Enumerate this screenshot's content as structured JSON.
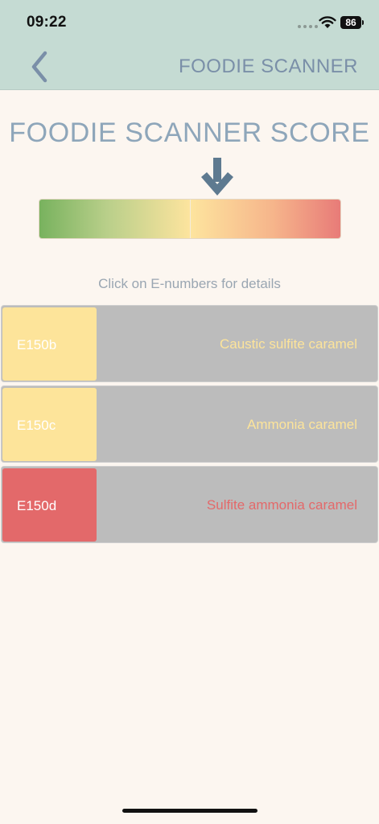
{
  "status_bar": {
    "time": "09:22",
    "battery": "86",
    "signal_icon": "signal-dots-icon",
    "wifi_icon": "wifi-icon"
  },
  "nav": {
    "back_icon": "chevron-left-icon",
    "title": "FOODIE SCANNER"
  },
  "score": {
    "title": "FOODIE SCANNER SCORE",
    "indicator_icon": "arrow-down-icon",
    "scale_colors": [
      "#78b25e",
      "#fde49e",
      "#e87b78"
    ]
  },
  "hint": "Click on E-numbers for details",
  "additives": [
    {
      "code": "E150b",
      "name": "Caustic sulfite caramel",
      "color": "#fde49a",
      "text_color": "#fde49a"
    },
    {
      "code": "E150c",
      "name": "Ammonia caramel",
      "color": "#fde49a",
      "text_color": "#fde49a"
    },
    {
      "code": "E150d",
      "name": "Sulfite ammonia caramel",
      "color": "#e3696a",
      "text_color": "#e3696a"
    }
  ],
  "colors": {
    "header_bg": "#c5dbd3",
    "page_bg": "#fcf6f0",
    "accent": "#7a8fa8",
    "row_bg": "#bcbcbc"
  }
}
